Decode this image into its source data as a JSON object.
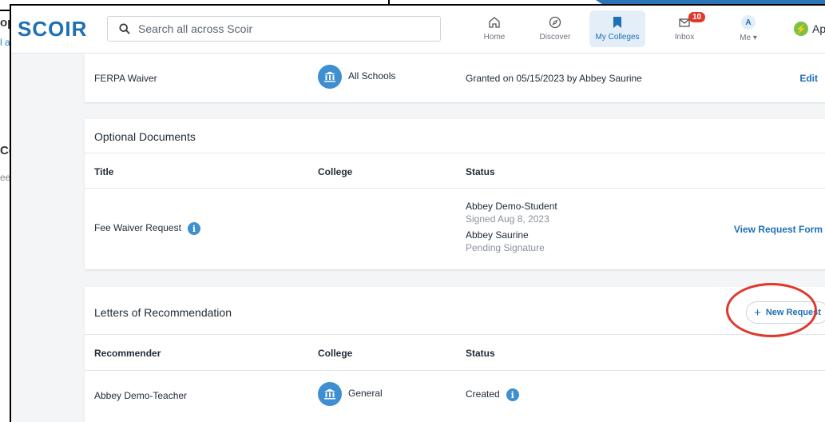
{
  "background": {
    "fragments": [
      "op",
      "l a",
      "Ce",
      "ee"
    ]
  },
  "header": {
    "logo": "SCOIR",
    "search_placeholder": "Search all across Scoir",
    "nav": [
      {
        "label": "Home",
        "icon": "home-icon"
      },
      {
        "label": "Discover",
        "icon": "compass-icon"
      },
      {
        "label": "My Colleges",
        "icon": "bookmark-icon",
        "active": true
      },
      {
        "label": "Inbox",
        "icon": "inbox-icon",
        "badge": "10"
      },
      {
        "label": "Me",
        "icon": "avatar",
        "avatar_letter": "A"
      }
    ],
    "app_label": "App"
  },
  "ferpa": {
    "title": "FERPA Waiver",
    "college": "All Schools",
    "status": "Granted on 05/15/2023 by Abbey Saurine",
    "action": "Edit"
  },
  "optional_documents": {
    "title": "Optional Documents",
    "columns": [
      "Title",
      "College",
      "Status"
    ],
    "rows": [
      {
        "title": "Fee Waiver Request",
        "signers": [
          {
            "name": "Abbey Demo-Student",
            "state": "Signed Aug 8, 2023"
          },
          {
            "name": "Abbey Saurine",
            "state": "Pending Signature"
          }
        ],
        "action": "View Request Form"
      }
    ]
  },
  "letters": {
    "title": "Letters of Recommendation",
    "new_request_label": "New Request",
    "columns": [
      "Recommender",
      "College",
      "Status"
    ],
    "rows": [
      {
        "recommender": "Abbey Demo-Teacher",
        "college": "General",
        "status": "Created"
      }
    ]
  },
  "colors": {
    "brand": "#1e6fb5",
    "annotation": "#e0382b",
    "badge": "#e0382b"
  }
}
